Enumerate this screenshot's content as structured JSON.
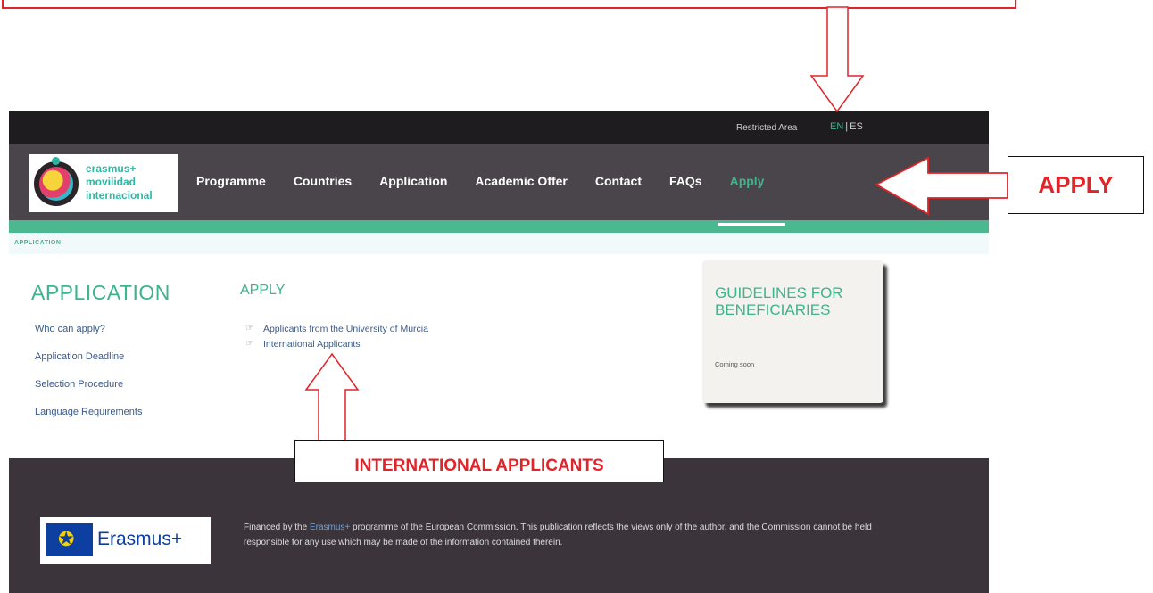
{
  "topbar": {
    "restricted_area": "Restricted Area",
    "lang_en": "EN",
    "lang_sep": "|",
    "lang_es": "ES"
  },
  "logo": {
    "line1": "erasmus+",
    "line2": "movilidad",
    "line3": "internacional"
  },
  "nav": {
    "items": [
      {
        "label": "Programme"
      },
      {
        "label": "Countries"
      },
      {
        "label": "Application"
      },
      {
        "label": "Academic Offer"
      },
      {
        "label": "Contact"
      },
      {
        "label": "FAQs"
      },
      {
        "label": "Apply"
      }
    ]
  },
  "breadcrumb": "APPLICATION",
  "sidebar": {
    "title": "APPLICATION",
    "links": [
      {
        "label": "Who can apply?"
      },
      {
        "label": "Application Deadline"
      },
      {
        "label": "Selection Procedure"
      },
      {
        "label": "Language Requirements"
      }
    ]
  },
  "main": {
    "heading": "APPLY",
    "links": [
      {
        "label": "Applicants from the University of Murcia"
      },
      {
        "label": "International Applicants"
      }
    ]
  },
  "guidelines": {
    "title": "GUIDELINES FOR BENEFICIARIES",
    "note": "Coming soon"
  },
  "footer": {
    "eu_logo_text": "Erasmus+",
    "text_before": "Financed by the ",
    "text_link": "Erasmus+",
    "text_after": " programme of the European Commission. This publication reflects the views only of the author, and the Commission cannot be held responsible for any use which may be made of the information contained therein."
  },
  "annotations": {
    "apply_callout": "APPLY",
    "intl_callout": "INTERNATIONAL APPLICANTS",
    "color": "#e0242a"
  },
  "colors": {
    "accent_green": "#3fb38a",
    "topbar_bg": "#1f1c1f",
    "nav_bg": "#4a454b",
    "footer_bg": "#3b353b"
  }
}
